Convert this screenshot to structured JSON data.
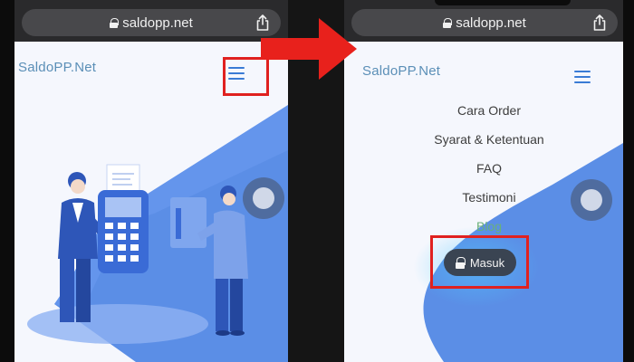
{
  "left_phone": {
    "url": "saldopp.net",
    "brand": "SaldoPP.Net",
    "icons": [
      "lock-icon",
      "share-icon",
      "hamburger-icon",
      "assistive-touch-icon"
    ]
  },
  "right_phone": {
    "url": "saldopp.net",
    "brand": "SaldoPP.Net",
    "menu": [
      {
        "label": "Cara Order"
      },
      {
        "label": "Syarat & Ketentuan"
      },
      {
        "label": "FAQ"
      },
      {
        "label": "Testimoni"
      },
      {
        "label": "Blog"
      }
    ],
    "login_label": "Masuk",
    "icons": [
      "lock-icon",
      "share-icon",
      "hamburger-icon",
      "padlock-icon",
      "assistive-touch-icon"
    ]
  },
  "colors": {
    "brand_text": "#5b8fb7",
    "accent_blue": "#5b8ee6",
    "highlight_red": "#e0211f",
    "arrow_red": "#e8211c",
    "menu_active": "#6ab07a",
    "login_bg": "#3a4452"
  }
}
